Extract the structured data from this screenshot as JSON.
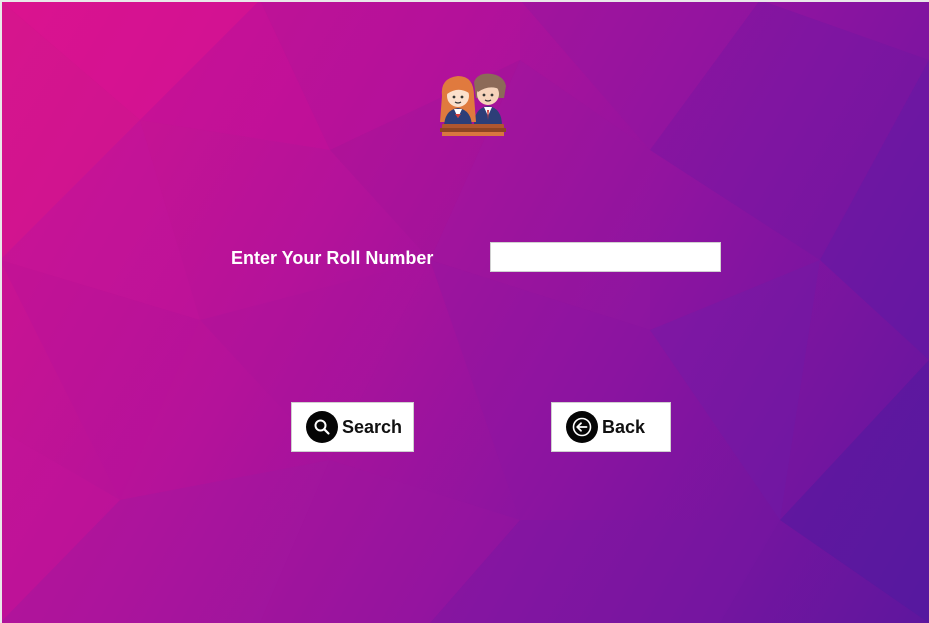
{
  "form": {
    "roll_label": "Enter Your Roll Number",
    "roll_value": "",
    "roll_placeholder": ""
  },
  "buttons": {
    "search_label": "Search",
    "back_label": "Back"
  },
  "icons": {
    "logo": "students-icon",
    "search": "search-icon",
    "back": "arrow-left-icon"
  },
  "colors": {
    "background_start": "#d4148e",
    "background_end": "#5e169e",
    "label_text": "#ffffff",
    "button_bg": "#ffffff",
    "icon_circle": "#050505"
  }
}
